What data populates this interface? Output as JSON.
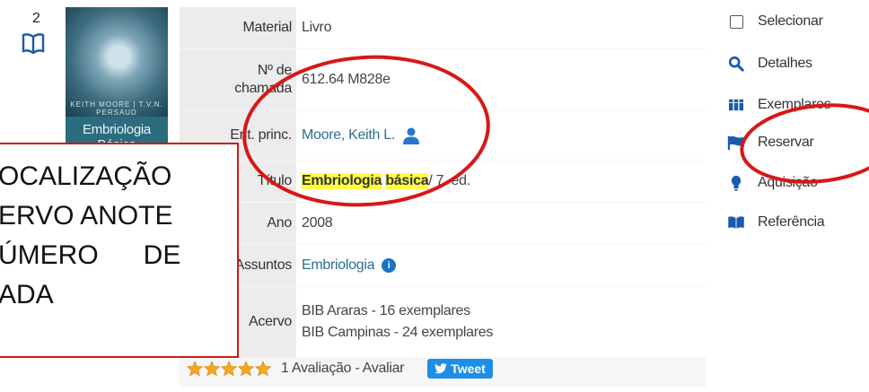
{
  "result": {
    "rank": "2",
    "cover": {
      "title": "Embriologia Básica",
      "author": "KEITH MOORE | T.V.N. PERSAUD"
    },
    "fields": {
      "material": {
        "label": "Material",
        "value": "Livro"
      },
      "call_number": {
        "label_line1": "Nº de",
        "label_line2": "chamada",
        "value": "612.64 M828e"
      },
      "main_entry": {
        "label": "Ent. princ.",
        "value": "Moore, Keith L."
      },
      "title": {
        "label": "Título",
        "highlight1": "Embriologia",
        "highlight2": "básica",
        "rest": " / 7. ed."
      },
      "year": {
        "label": "Ano",
        "value": "2008"
      },
      "subjects": {
        "label": "Assuntos",
        "value": "Embriologia",
        "info_glyph": "i"
      },
      "holdings": {
        "label": "Acervo",
        "line1": "BIB Araras - 16 exemplares",
        "line2": "BIB Campinas - 24 exemplares"
      }
    },
    "rating": {
      "stars": 5,
      "text": "1 Avaliação - Avaliar",
      "tweet": "Tweet"
    }
  },
  "actions": [
    {
      "label": "Selecionar",
      "icon": "checkbox-icon"
    },
    {
      "label": "Detalhes",
      "icon": "magnifier-icon"
    },
    {
      "label": "Exemplares",
      "icon": "books-icon"
    },
    {
      "label": "Reservar",
      "icon": "flag-icon"
    },
    {
      "label": "Aquisição",
      "icon": "lightbulb-icon"
    },
    {
      "label": "Referência",
      "icon": "open-book-icon"
    }
  ],
  "annotation": {
    "line1": "OCALIZAÇÃO",
    "line2": "ERVO ANOTE",
    "line3": "ÚMERO      DE",
    "line4": "ADA"
  },
  "colors": {
    "annotation_red": "#c91a1a",
    "link_blue": "#2a6f93",
    "highlight": "#ffff44",
    "tweet_blue": "#1d8ee6",
    "icon_blue": "#1a5ab0"
  }
}
